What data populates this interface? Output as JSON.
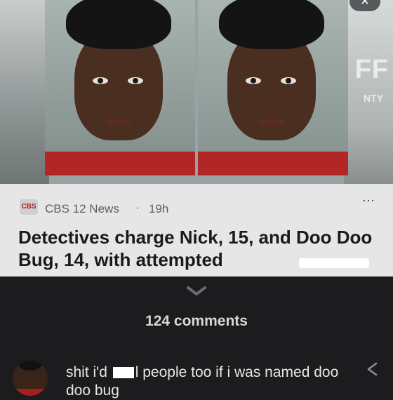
{
  "article": {
    "source_name": "CBS 12 News",
    "source_logo_text": "CBS",
    "time_ago": "19h",
    "dot": "·",
    "more_icon": "⋯",
    "headline": "Detectives charge Nick, 15, and Doo Doo Bug, 14, with attempted",
    "sign_text": "FF",
    "sign_sub": "NTY",
    "close_label": "✕"
  },
  "comments_section": {
    "count_label": "124 comments"
  },
  "comment": {
    "text_before": "shit i'd",
    "text_censored_fragment": "l",
    "text_after": "people too if i was named doo doo bug"
  },
  "colors": {
    "background": "#1c1c1e",
    "card": "#e6e6e6",
    "shirt_red": "#b32626"
  }
}
